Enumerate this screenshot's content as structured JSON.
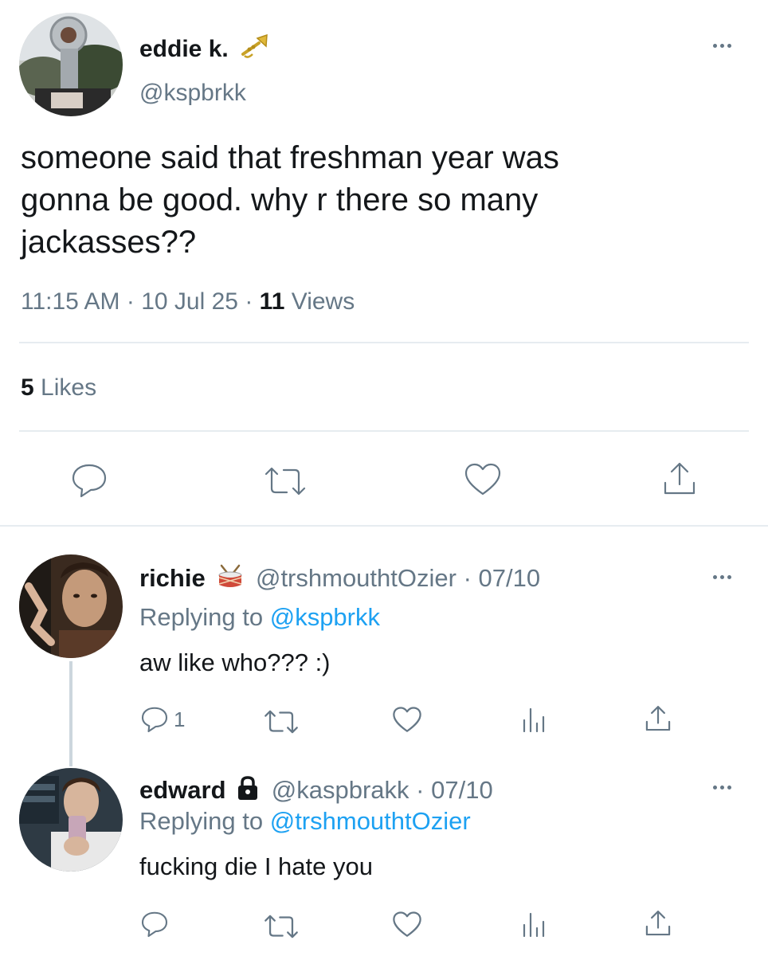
{
  "main_tweet": {
    "display_name": "eddie k.",
    "handle": "@kspbrkk",
    "name_emoji": "trumpet-emoji",
    "text_lines": [
      "someone said that freshman year was",
      "gonna be good. why r there so many",
      "jackasses??"
    ],
    "time": "11:15 AM",
    "date": "10 Jul 25",
    "views_count": "11",
    "views_label": "Views",
    "likes_count": "5",
    "likes_label": "Likes",
    "separator": "·"
  },
  "replies": [
    {
      "display_name": "richie",
      "name_emoji": "drum-emoji",
      "handle": "@trshmouthtOzier",
      "date": "07/10",
      "replying_prefix": "Replying to",
      "replying_handle": "@kspbrkk",
      "text": "aw like who??? :)",
      "reply_count": "1"
    },
    {
      "display_name": "edward",
      "name_icon": "lock-icon",
      "handle": "@kaspbrakk",
      "date": "07/10",
      "replying_prefix": "Replying to",
      "replying_handle": "@trshmouthtOzier",
      "text": "fucking die I hate you",
      "reply_count": ""
    }
  ],
  "colors": {
    "text": "#14171a",
    "secondary": "#657786",
    "link": "#1da1f2",
    "divider": "#e6ecf0"
  }
}
